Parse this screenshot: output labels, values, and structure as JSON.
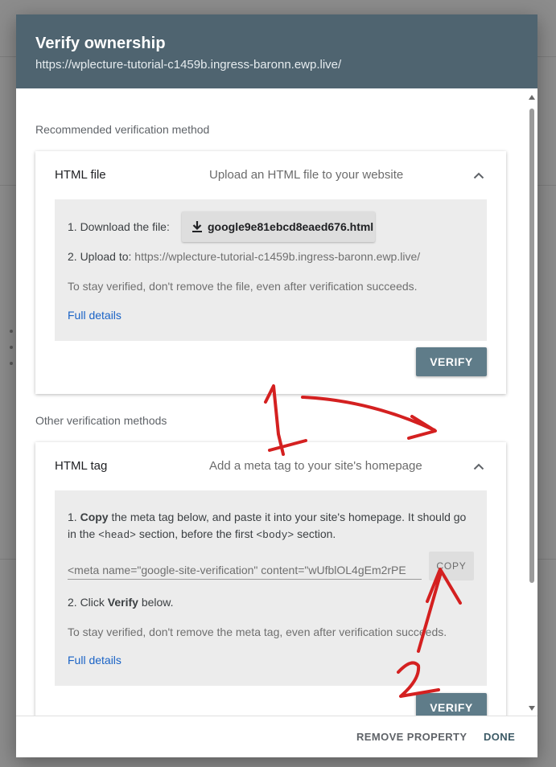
{
  "dialog": {
    "title": "Verify ownership",
    "url": "https://wplecture-tutorial-c1459b.ingress-baronn.ewp.live/"
  },
  "recommended": {
    "section_label": "Recommended verification method",
    "method_name": "HTML file",
    "method_description": "Upload an HTML file to your website",
    "step1_label": "1. Download the file:",
    "download_filename": "google9e81ebcd8eaed676.html",
    "step2_label": "2. Upload to:",
    "step2_url": "https://wplecture-tutorial-c1459b.ingress-baronn.ewp.live/",
    "note": "To stay verified, don't remove the file, even after verification succeeds.",
    "details_link": "Full details",
    "verify_label": "VERIFY"
  },
  "other": {
    "section_label": "Other verification methods",
    "method_name": "HTML tag",
    "method_description": "Add a meta tag to your site's homepage",
    "step1_num": "1.",
    "step1_bold": "Copy",
    "step1_text_a": "the meta tag below, and paste it into your site's homepage. It should",
    "step1_text_b": "go in the",
    "head_tag": "<head>",
    "step1_text_c": "section, before the first",
    "body_tag": "<body>",
    "step1_text_d": "section.",
    "meta_value": "<meta name=\"google-site-verification\" content=\"wUfblOL4gEm2rPE",
    "copy_label": "COPY",
    "step2_text_a": "2. Click",
    "step2_bold": "Verify",
    "step2_text_b": "below.",
    "note": "To stay verified, don't remove the meta tag, even after verification succeeds.",
    "details_link": "Full details",
    "verify_label": "VERIFY"
  },
  "footer": {
    "remove_label": "REMOVE PROPERTY",
    "done_label": "DONE"
  },
  "annotations": {
    "number_1": "1",
    "number_2": "2",
    "color": "#d42020"
  },
  "colors": {
    "header_bg": "#4f6470",
    "verify_bg": "#5f7c89",
    "link": "#1a63c6",
    "done": "#3c5a66"
  }
}
